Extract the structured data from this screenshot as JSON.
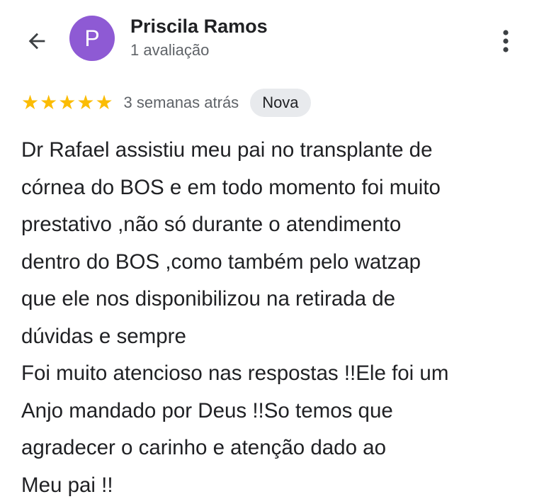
{
  "header": {
    "avatar_letter": "P",
    "avatar_color": "#8e5ad4",
    "reviewer_name": "Priscila Ramos",
    "review_count": "1 avaliação",
    "back_icon": "arrow-left-icon",
    "more_icon": "more-vert-icon"
  },
  "review": {
    "rating": 5,
    "max_rating": 5,
    "star_color": "#fbbc04",
    "time_ago": "3 semanas atrás",
    "badge": "Nova",
    "lines": [
      "Dr Rafael assistiu meu pai no transplante de",
      "córnea do BOS e em todo momento foi muito",
      "prestativo ,não só durante o atendimento",
      "dentro do BOS ,como também pelo watzap",
      "que ele nos disponibilizou na retirada de",
      "dúvidas e sempre",
      "Foi muito atencioso nas respostas !!Ele foi um",
      "Anjo mandado por Deus !!So temos que",
      "agradecer o carinho e atenção dado ao",
      "Meu pai !!"
    ]
  }
}
